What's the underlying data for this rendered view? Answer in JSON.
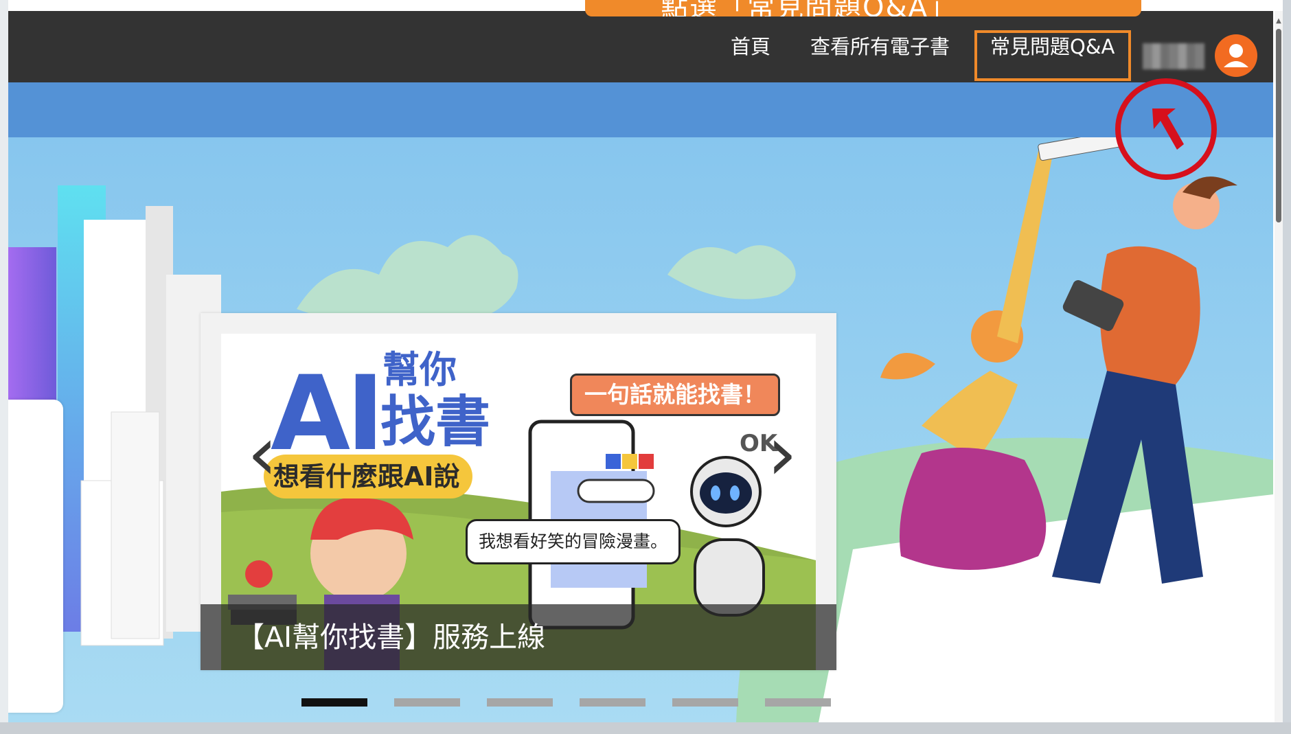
{
  "hint_banner": {
    "text": "點選「常見問題Q&A」"
  },
  "nav": {
    "items": [
      {
        "label": "首頁"
      },
      {
        "label": "查看所有電子書"
      },
      {
        "label": "常見問題Q&A"
      }
    ]
  },
  "carousel": {
    "caption": "【AI幫你找書】服務上線",
    "slide_count": 6,
    "active_index": 0,
    "banner": {
      "ai": "AI",
      "help": "幫你",
      "find": "找書",
      "tagline": "想看什麼跟AI說",
      "one_sentence": "一句話就能找書！",
      "bubble": "我想看好笑的冒險漫畫。",
      "ok": "OK"
    }
  },
  "colors": {
    "nav_bg": "#333333",
    "highlight": "#f08a2a",
    "avatar": "#f26b21",
    "annotation": "#d6101c"
  },
  "icons": {
    "avatar": "user-avatar-icon",
    "prev": "chevron-left-icon",
    "next": "chevron-right-icon",
    "pointer": "arrow-pointer-icon"
  }
}
